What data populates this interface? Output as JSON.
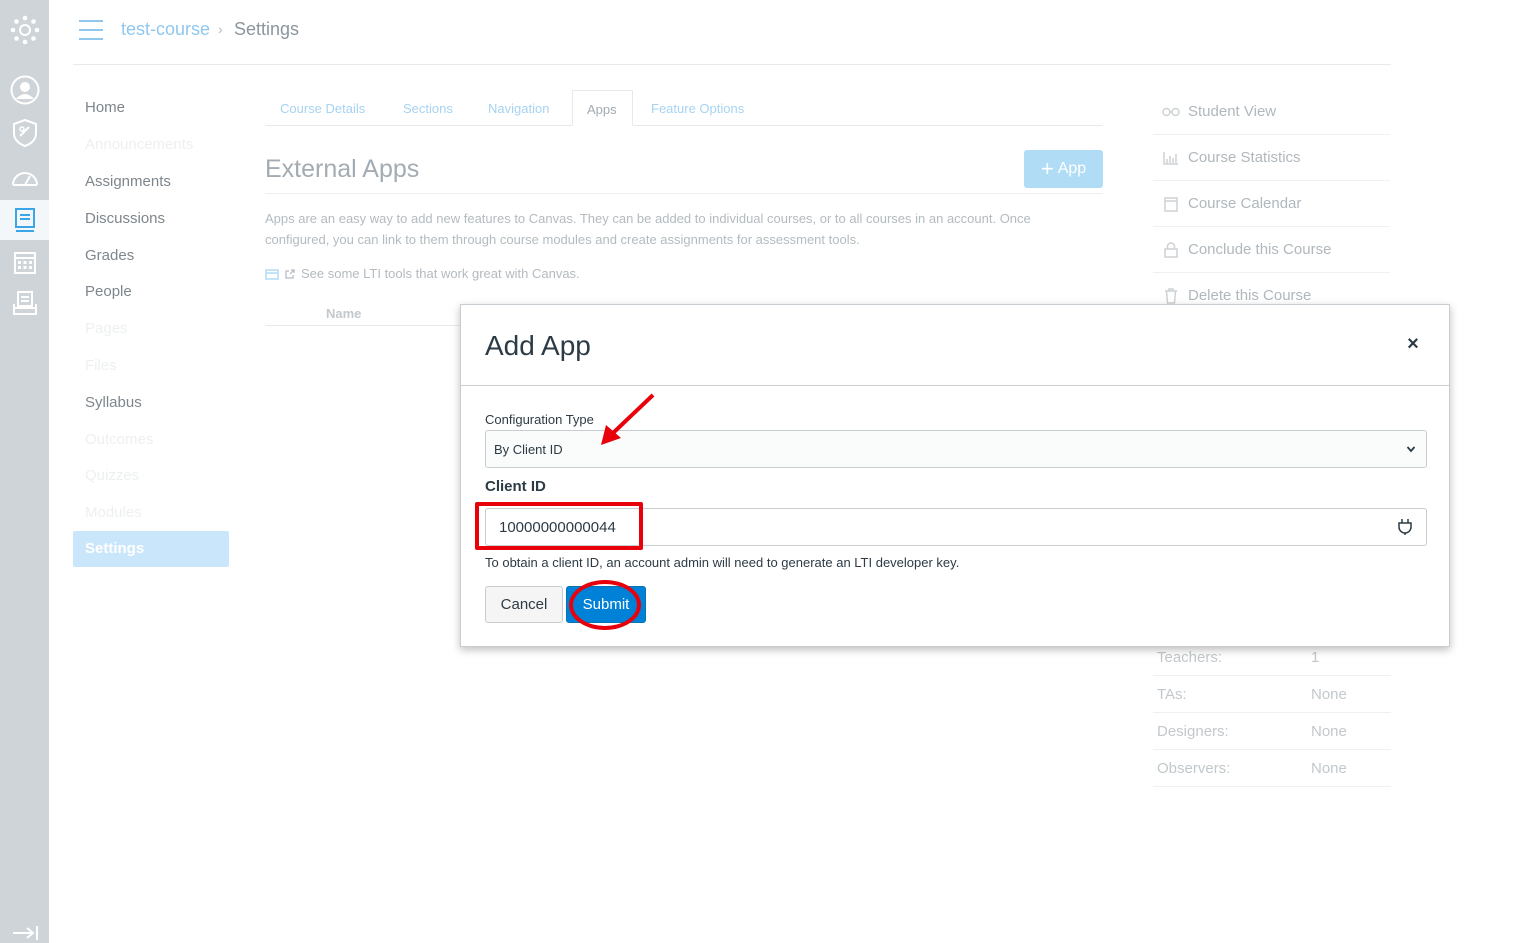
{
  "breadcrumb": {
    "course": "test-course",
    "current": "Settings"
  },
  "course_nav": [
    {
      "label": "Home",
      "enabled": true
    },
    {
      "label": "Announcements",
      "enabled": false
    },
    {
      "label": "Assignments",
      "enabled": true
    },
    {
      "label": "Discussions",
      "enabled": true
    },
    {
      "label": "Grades",
      "enabled": true
    },
    {
      "label": "People",
      "enabled": true
    },
    {
      "label": "Pages",
      "enabled": false
    },
    {
      "label": "Files",
      "enabled": false
    },
    {
      "label": "Syllabus",
      "enabled": true
    },
    {
      "label": "Outcomes",
      "enabled": false
    },
    {
      "label": "Quizzes",
      "enabled": false
    },
    {
      "label": "Modules",
      "enabled": false
    },
    {
      "label": "Settings",
      "enabled": true,
      "active": true
    }
  ],
  "tabs": [
    "Course Details",
    "Sections",
    "Navigation",
    "Apps",
    "Feature Options"
  ],
  "external_apps": {
    "title": "External Apps",
    "add_button": "App",
    "description": "Apps are an easy way to add new features to Canvas. They can be added to individual courses, or to all courses in an account. Once configured, you can link to them through course modules and create assignments for assessment tools.",
    "lti_link": "See some LTI tools that work great with Canvas.",
    "table_header_name": "Name"
  },
  "sidebar": {
    "actions": [
      "Student View",
      "Course Statistics",
      "Course Calendar",
      "Conclude this Course",
      "Delete this Course"
    ],
    "action_icons": [
      "glasses-icon",
      "chart-icon",
      "calendar-icon",
      "lock-icon",
      "trash-icon"
    ],
    "stats": [
      {
        "label": "Teachers:",
        "value": "1"
      },
      {
        "label": "TAs:",
        "value": "None"
      },
      {
        "label": "Designers:",
        "value": "None"
      },
      {
        "label": "Observers:",
        "value": "None"
      }
    ]
  },
  "modal": {
    "title": "Add App",
    "close_glyph": "×",
    "config_type_label": "Configuration Type",
    "config_type_value": "By Client ID",
    "client_id_label": "Client ID",
    "client_id_value": "10000000000044",
    "client_id_hint": "To obtain a client ID, an account admin will need to generate an LTI developer key.",
    "cancel_label": "Cancel",
    "submit_label": "Submit"
  },
  "colors": {
    "global_nav_bg": "#cfd4d8",
    "link_blue": "#8fc8ee",
    "primary_button": "#0081d8",
    "annotation_red": "#e8000b"
  }
}
